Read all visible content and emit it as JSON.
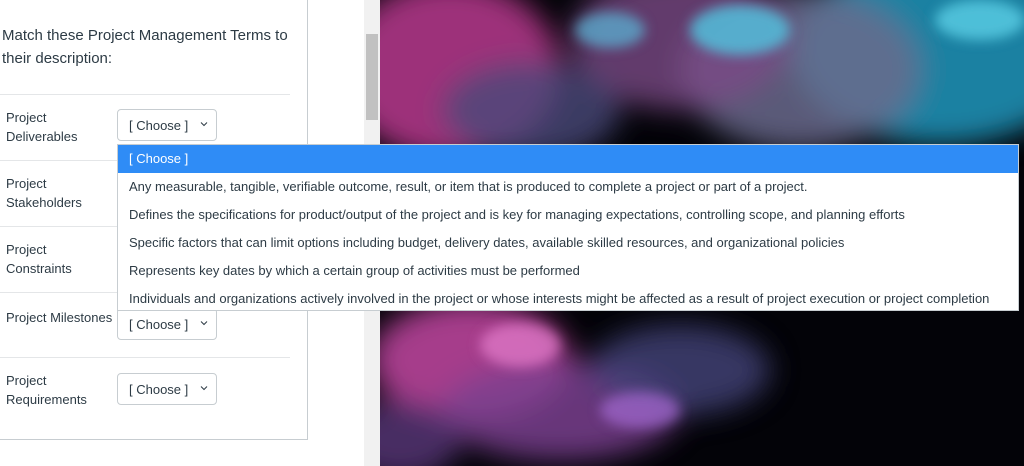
{
  "question": {
    "text": "Match these Project Management Terms to their description:"
  },
  "rows": [
    {
      "label": "Project Deliverables",
      "select_value": "[ Choose ]"
    },
    {
      "label": "Project Stakeholders",
      "select_value": ""
    },
    {
      "label": "Project Constraints",
      "select_value": ""
    },
    {
      "label": "Project Milestones",
      "select_value": "[ Choose ]"
    },
    {
      "label": "Project Requirements",
      "select_value": "[ Choose ]"
    }
  ],
  "dropdown": {
    "options": [
      "[ Choose ]",
      "Any measurable, tangible, verifiable outcome, result, or item that is produced to complete a project or part of a project.",
      "Defines the specifications for product/output of the project and is key for managing expectations, controlling scope, and planning efforts",
      "Specific factors that can limit options including budget, delivery dates, available skilled resources, and organizational policies",
      "Represents key dates by which a certain group of activities must be performed",
      "Individuals and organizations actively involved in the project or whose interests might be affected as a result of project execution or project completion"
    ],
    "selected_index": 0
  },
  "colors": {
    "highlight": "#2f8cf6",
    "text": "#2d3b45",
    "border": "#c7cdd1"
  }
}
